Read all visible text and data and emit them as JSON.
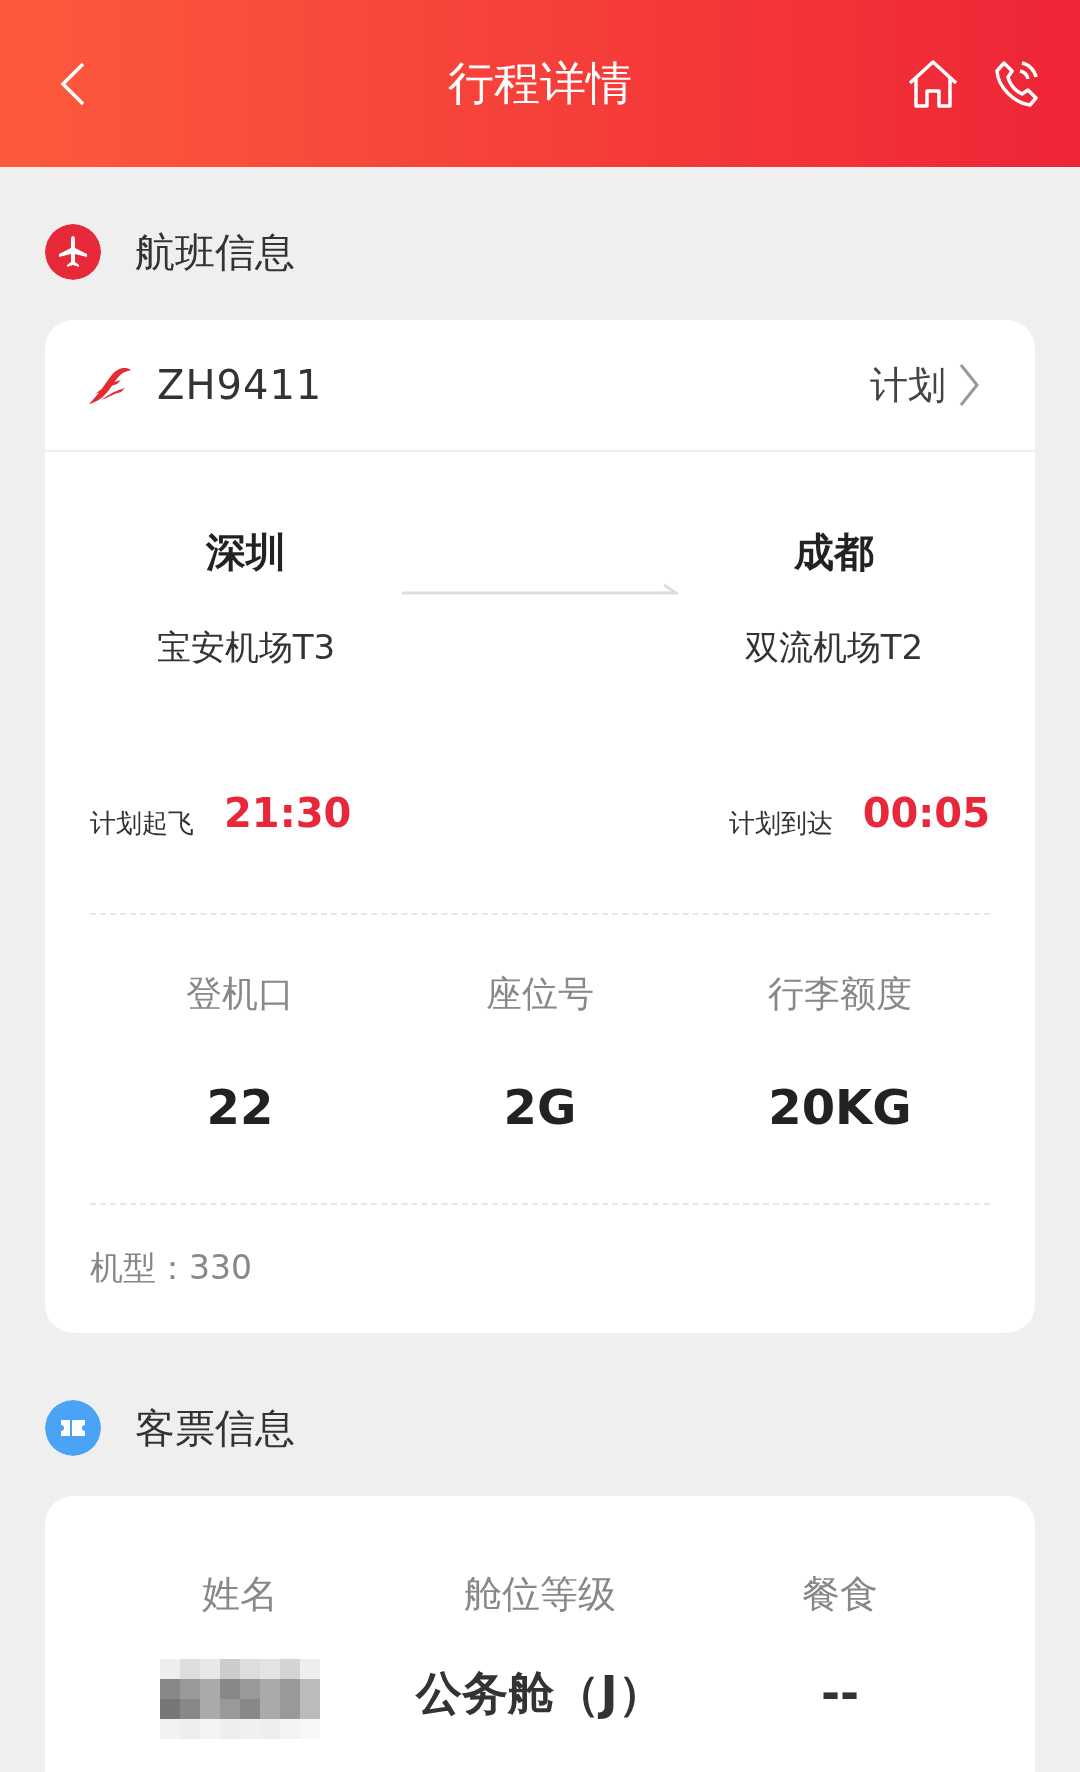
{
  "header": {
    "title": "行程详情"
  },
  "flight_section": {
    "title": "航班信息"
  },
  "flight": {
    "number": "ZH9411",
    "status": "计划",
    "departure": {
      "city": "深圳",
      "airport": "宝安机场T3",
      "time_label": "计划起飞",
      "time": "21:30"
    },
    "arrival": {
      "city": "成都",
      "airport": "双流机场T2",
      "time_label": "计划到达",
      "time": "00:05"
    },
    "details": [
      {
        "label": "登机口",
        "value": "22"
      },
      {
        "label": "座位号",
        "value": "2G"
      },
      {
        "label": "行李额度",
        "value": "20KG"
      }
    ],
    "aircraft": "机型：330"
  },
  "ticket_section": {
    "title": "客票信息"
  },
  "ticket": [
    {
      "label": "姓名",
      "kind": "redacted"
    },
    {
      "label": "舱位等级",
      "kind": "text",
      "value": "公务舱（J）"
    },
    {
      "label": "餐食",
      "kind": "text",
      "value": "--"
    }
  ]
}
